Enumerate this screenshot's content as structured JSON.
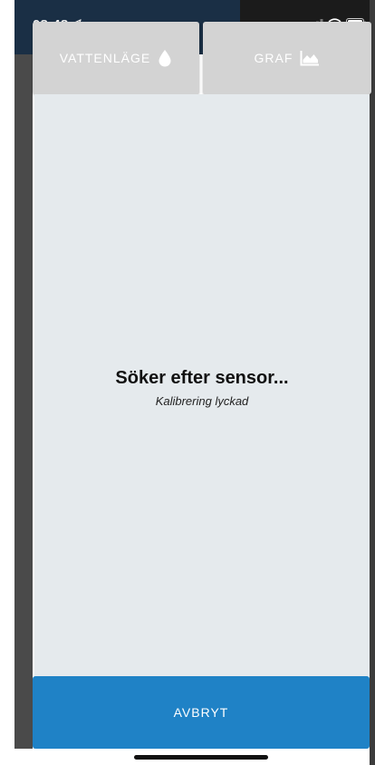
{
  "status_bar": {
    "time": "08:48",
    "location_icon": "location-arrow-icon",
    "signal_icon": "cellular-signal-icon",
    "wifi_icon": "wifi-icon",
    "battery_icon": "battery-icon"
  },
  "tabs": [
    {
      "label": "VATTENLÄGE",
      "icon": "water-drop-icon"
    },
    {
      "label": "GRAF",
      "icon": "area-chart-icon"
    }
  ],
  "modal": {
    "title": "Söker efter sensor...",
    "subtitle": "Kalibrering lyckad"
  },
  "actions": {
    "cancel_label": "AVBRYT"
  },
  "colors": {
    "tab_background": "#d3d3d3",
    "panel_background": "#e5eaed",
    "cancel_button": "#1f82c6",
    "header_background": "#1a2f45"
  }
}
